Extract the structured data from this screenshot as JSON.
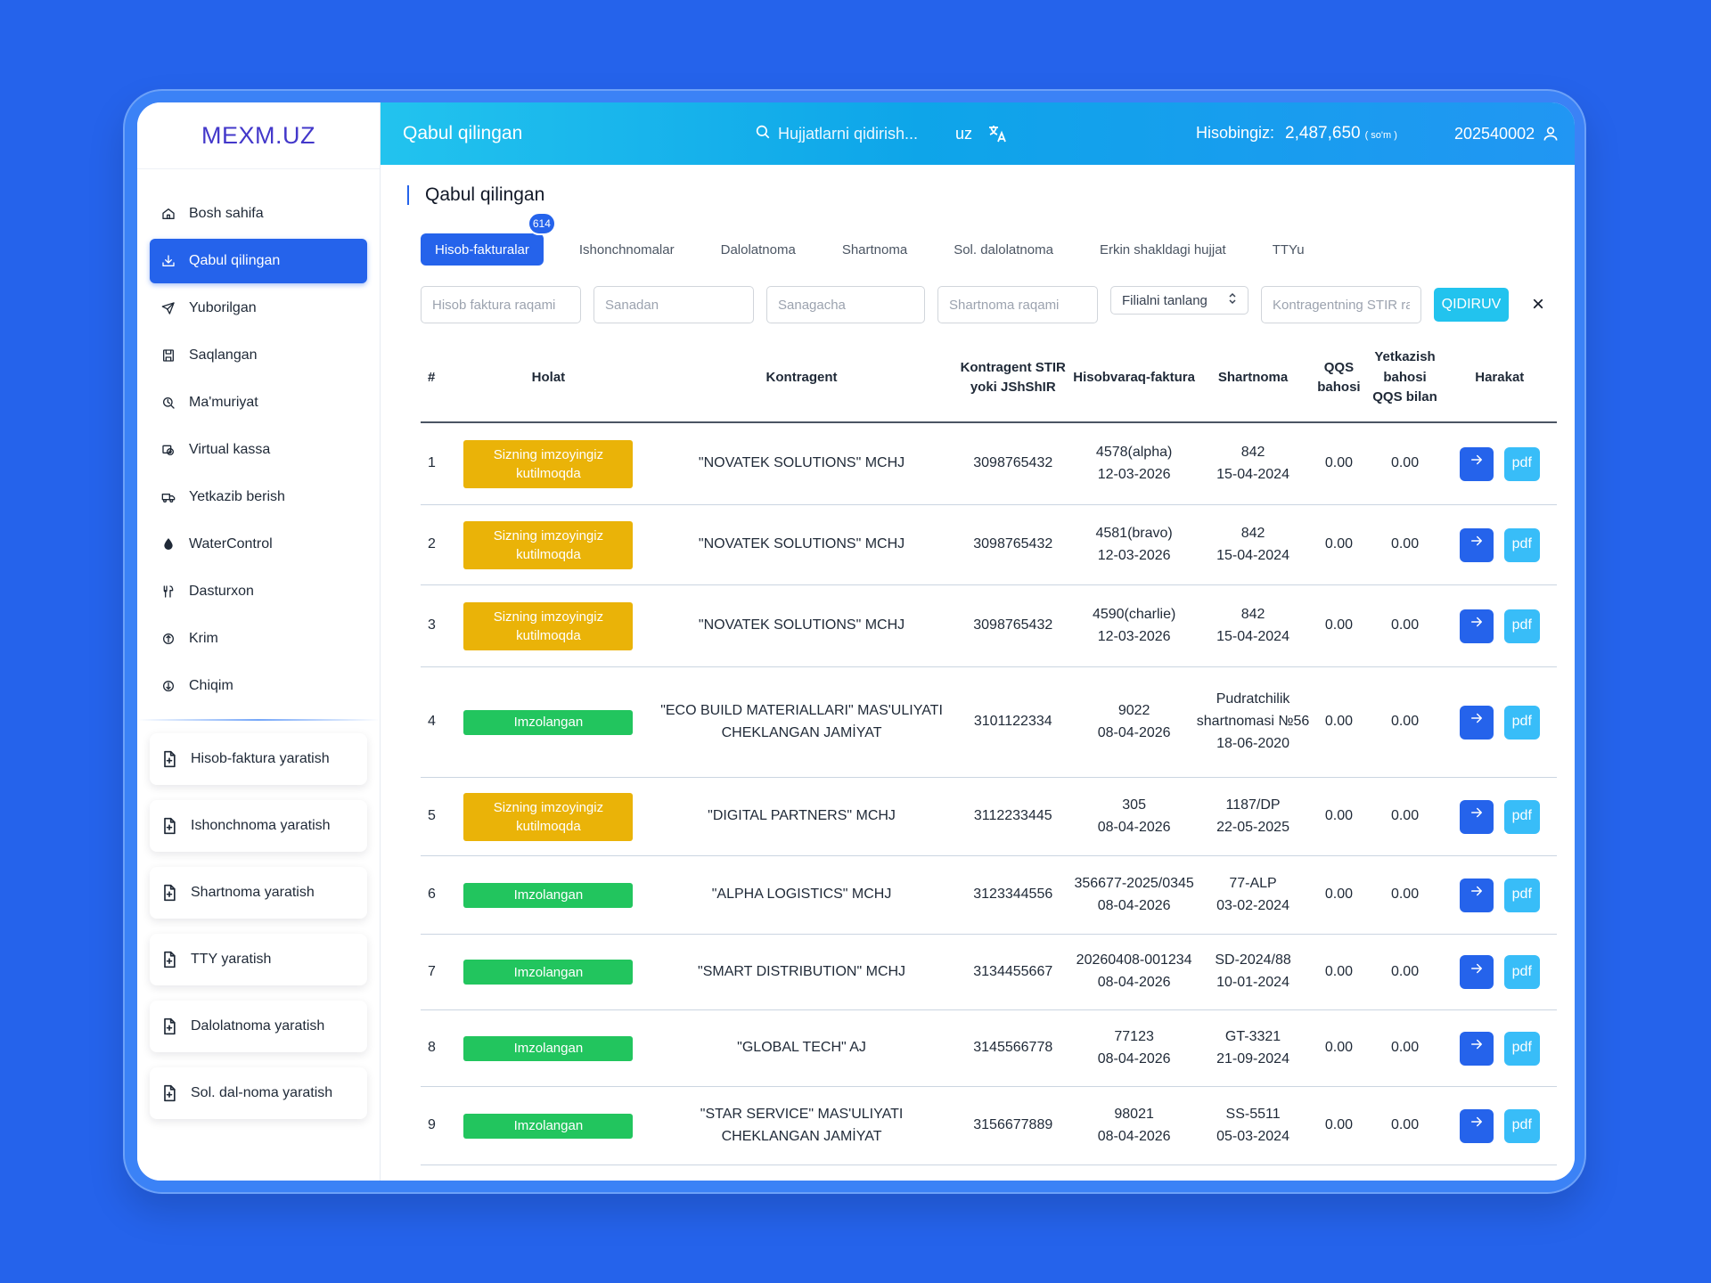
{
  "app": {
    "logo": "MEXM.UZ"
  },
  "sidebar": {
    "items": [
      {
        "label": "Bosh sahifa",
        "icon": "home-icon"
      },
      {
        "label": "Qabul qilingan",
        "icon": "inbox-download-icon"
      },
      {
        "label": "Yuborilgan",
        "icon": "send-icon"
      },
      {
        "label": "Saqlangan",
        "icon": "save-icon"
      },
      {
        "label": "Ma'muriyat",
        "icon": "admin-icon"
      },
      {
        "label": "Virtual kassa",
        "icon": "cash-register-icon"
      },
      {
        "label": "Yetkazib berish",
        "icon": "truck-icon"
      },
      {
        "label": "WaterControl",
        "icon": "water-drop-icon"
      },
      {
        "label": "Dasturxon",
        "icon": "cutlery-icon"
      },
      {
        "label": "Krim",
        "icon": "income-icon"
      },
      {
        "label": "Chiqim",
        "icon": "expense-icon"
      }
    ],
    "active_index": 1,
    "create": [
      "Hisob-faktura yaratish",
      "Ishonchnoma yaratish",
      "Shartnoma yaratish",
      "TTY yaratish",
      "Dalolatnoma yaratish",
      "Sol. dal-noma yaratish"
    ]
  },
  "header": {
    "title": "Qabul qilingan",
    "search_placeholder": "Hujjatlarni qidirish...",
    "lang": "uz",
    "balance_label": "Hisobingiz:",
    "balance_amount": "2,487,650",
    "balance_currency": "( so'm )",
    "account_id": "202540002"
  },
  "page": {
    "title": "Qabul qilingan",
    "badge": "614",
    "tabs": [
      "Hisob-fakturalar",
      "Ishonchnomalar",
      "Dalolatnoma",
      "Shartnoma",
      "Sol. dalolatnoma",
      "Erkin shakldagi hujjat",
      "TTYu"
    ],
    "active_tab": 0
  },
  "filters": {
    "invoice_no": "Hisob faktura raqami",
    "date_from": "Sanadan",
    "date_to": "Sanagacha",
    "contract_no": "Shartnoma raqami",
    "branch": "Filialni tanlang",
    "stir": "Kontragentning STIR raqami",
    "search_btn": "QIDIRUV",
    "clear": "×"
  },
  "table": {
    "headers": [
      "#",
      "Holat",
      "Kontragent",
      "Kontragent STIR yoki JShShIR",
      "Hisobvaraq-faktura",
      "Shartnoma",
      "QQS bahosi",
      "Yetkazish bahosi QQS bilan",
      "Harakat"
    ],
    "status_labels": {
      "wait": "Sizning imzoyingiz kutilmoqda",
      "ok": "Imzolangan"
    },
    "status_colors": {
      "wait": "#eab308",
      "ok": "#22c55e"
    },
    "pdf_label": "pdf",
    "rows": [
      {
        "n": "1",
        "status": "wait",
        "kontragent": "\"NOVATEK SOLUTIONS\" MCHJ",
        "stir": "3098765432",
        "hf_no": "4578(alpha)",
        "hf_date": "12-03-2026",
        "sh_no": "842",
        "sh_date": "15-04-2024",
        "qqs": "0.00",
        "yb": "0.00",
        "h": 92
      },
      {
        "n": "2",
        "status": "wait",
        "kontragent": "\"NOVATEK SOLUTIONS\" MCHJ",
        "stir": "3098765432",
        "hf_no": "4581(bravo)",
        "hf_date": "12-03-2026",
        "sh_no": "842",
        "sh_date": "15-04-2024",
        "qqs": "0.00",
        "yb": "0.00",
        "h": 90
      },
      {
        "n": "3",
        "status": "wait",
        "kontragent": "\"NOVATEK SOLUTIONS\" MCHJ",
        "stir": "3098765432",
        "hf_no": "4590(charlie)",
        "hf_date": "12-03-2026",
        "sh_no": "842",
        "sh_date": "15-04-2024",
        "qqs": "0.00",
        "yb": "0.00",
        "h": 92
      },
      {
        "n": "4",
        "status": "ok",
        "kontragent": "\"ECO BUILD MATERIALLARI\" MAS'ULIYATI CHEKLANGAN JAMİYAT",
        "stir": "3101122334",
        "hf_no": "9022",
        "hf_date": "08-04-2026",
        "sh_no": "Pudratchilik shartnomasi №56",
        "sh_date": "18-06-2020",
        "qqs": "0.00",
        "yb": "0.00",
        "h": 124
      },
      {
        "n": "5",
        "status": "wait",
        "kontragent": "\"DIGITAL PARTNERS\" MCHJ",
        "stir": "3112233445",
        "hf_no": "305",
        "hf_date": "08-04-2026",
        "sh_no": "1187/DP",
        "sh_date": "22-05-2025",
        "qqs": "0.00",
        "yb": "0.00",
        "h": 88
      },
      {
        "n": "6",
        "status": "ok",
        "kontragent": "\"ALPHA LOGISTICS\" MCHJ",
        "stir": "3123344556",
        "hf_no": "356677-2025/0345",
        "hf_date": "08-04-2026",
        "sh_no": "77-ALP",
        "sh_date": "03-02-2024",
        "qqs": "0.00",
        "yb": "0.00",
        "h": 88
      },
      {
        "n": "7",
        "status": "ok",
        "kontragent": "\"SMART DISTRIBUTION\" MCHJ",
        "stir": "3134455667",
        "hf_no": "20260408-001234",
        "hf_date": "08-04-2026",
        "sh_no": "SD-2024/88",
        "sh_date": "10-01-2024",
        "qqs": "0.00",
        "yb": "0.00",
        "h": 85
      },
      {
        "n": "8",
        "status": "ok",
        "kontragent": "\"GLOBAL TECH\" AJ",
        "stir": "3145566778",
        "hf_no": "77123",
        "hf_date": "08-04-2026",
        "sh_no": "GT-3321",
        "sh_date": "21-09-2024",
        "qqs": "0.00",
        "yb": "0.00",
        "h": 86
      },
      {
        "n": "9",
        "status": "ok",
        "kontragent": "\"STAR SERVICE\" MAS'ULIYATI CHEKLANGAN JAMİYAT",
        "stir": "3156677889",
        "hf_no": "98021",
        "hf_date": "08-04-2026",
        "sh_no": "SS-5511",
        "sh_date": "05-03-2024",
        "qqs": "0.00",
        "yb": "0.00",
        "h": 88
      }
    ]
  }
}
